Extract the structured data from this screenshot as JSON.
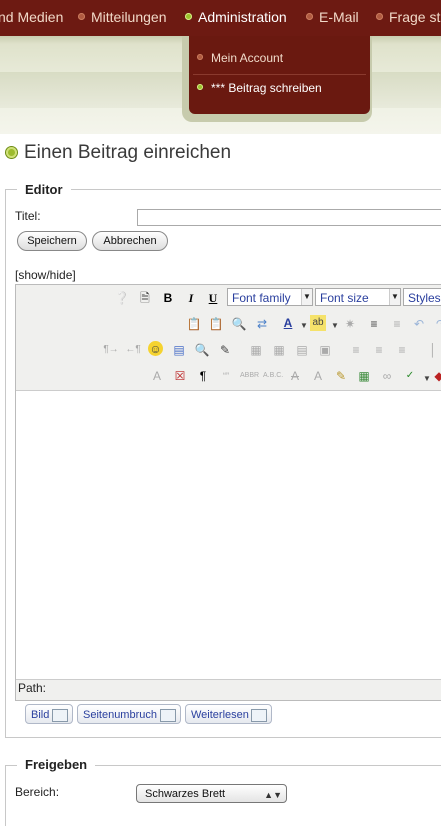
{
  "nav": {
    "items": [
      {
        "label": "nd Medien"
      },
      {
        "label": "Mitteilungen"
      },
      {
        "label": "Administration"
      },
      {
        "label": "E-Mail"
      },
      {
        "label": "Frage st"
      }
    ],
    "dropdown": [
      {
        "label": "Mein Account"
      },
      {
        "label": "*** Beitrag schreiben"
      }
    ]
  },
  "page": {
    "title": "Einen Beitrag einreichen"
  },
  "editor_section": {
    "legend": "Editor",
    "title_label": "Titel:",
    "title_value": "",
    "save_label": "Speichern",
    "cancel_label": "Abbrechen",
    "toggle_label": "[show/hide]"
  },
  "editor": {
    "font_family": "Font family",
    "font_size": "Font size",
    "styles": "Styles",
    "path_label": "Path:",
    "buttons": [
      {
        "label": "Bild"
      },
      {
        "label": "Seitenumbruch"
      },
      {
        "label": "Weiterlesen"
      }
    ]
  },
  "release_section": {
    "legend": "Freigeben",
    "area_label": "Bereich:",
    "area_value": "Schwarzes Brett"
  },
  "colors": {
    "nav_bg": "#6d1a12",
    "accent": "#9cc22c"
  }
}
